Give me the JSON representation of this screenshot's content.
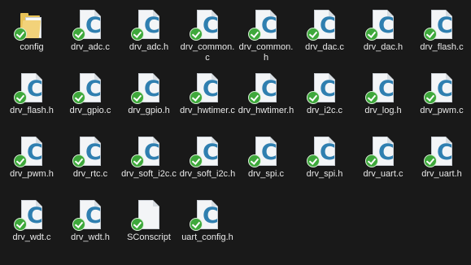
{
  "files": [
    {
      "name": "config",
      "type": "folder"
    },
    {
      "name": "drv_adc.c",
      "type": "c-file"
    },
    {
      "name": "drv_adc.h",
      "type": "c-file"
    },
    {
      "name": "drv_common.c",
      "type": "c-file"
    },
    {
      "name": "drv_common.h",
      "type": "c-file"
    },
    {
      "name": "drv_dac.c",
      "type": "c-file"
    },
    {
      "name": "drv_dac.h",
      "type": "c-file"
    },
    {
      "name": "drv_flash.c",
      "type": "c-file"
    },
    {
      "name": "drv_flash.h",
      "type": "c-file"
    },
    {
      "name": "drv_gpio.c",
      "type": "c-file"
    },
    {
      "name": "drv_gpio.h",
      "type": "c-file"
    },
    {
      "name": "drv_hwtimer.c",
      "type": "c-file"
    },
    {
      "name": "drv_hwtimer.h",
      "type": "c-file"
    },
    {
      "name": "drv_i2c.c",
      "type": "c-file"
    },
    {
      "name": "drv_log.h",
      "type": "c-file"
    },
    {
      "name": "drv_pwm.c",
      "type": "c-file"
    },
    {
      "name": "drv_pwm.h",
      "type": "c-file"
    },
    {
      "name": "drv_rtc.c",
      "type": "c-file"
    },
    {
      "name": "drv_soft_i2c.c",
      "type": "c-file"
    },
    {
      "name": "drv_soft_i2c.h",
      "type": "c-file"
    },
    {
      "name": "drv_spi.c",
      "type": "c-file"
    },
    {
      "name": "drv_spi.h",
      "type": "c-file"
    },
    {
      "name": "drv_uart.c",
      "type": "c-file"
    },
    {
      "name": "drv_uart.h",
      "type": "c-file"
    },
    {
      "name": "drv_wdt.c",
      "type": "c-file"
    },
    {
      "name": "drv_wdt.h",
      "type": "c-file"
    },
    {
      "name": "SConscript",
      "type": "generic-file"
    },
    {
      "name": "uart_config.h",
      "type": "c-file"
    }
  ],
  "colors": {
    "background": "#191919",
    "c_letter": "#2f7fb0",
    "sync_check": "#3ea83b",
    "label_text": "#e8e8e8"
  },
  "icons": {
    "folder": "folder-icon",
    "c-file": "c-source-file-icon",
    "generic-file": "blank-file-icon",
    "status": "sync-check-icon"
  }
}
